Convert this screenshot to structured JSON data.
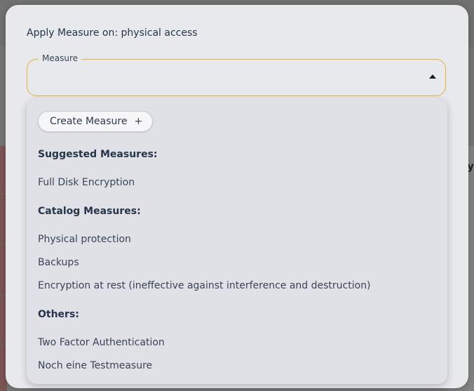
{
  "dialog": {
    "title": "Apply Measure on: physical access",
    "measure_field": {
      "label": "Measure",
      "value": ""
    }
  },
  "dropdown": {
    "create_button_label": "Create Measure",
    "create_button_icon": "+",
    "groups": [
      {
        "heading": "Suggested Measures:",
        "options": [
          "Full Disk Encryption"
        ]
      },
      {
        "heading": "Catalog Measures:",
        "options": [
          "Physical protection",
          "Backups",
          "Encryption at rest (ineffective against interference and destruction)"
        ]
      },
      {
        "heading": "Others:",
        "options": [
          "Two Factor Authentication",
          "Noch eine Testmeasure"
        ]
      }
    ]
  },
  "background": {
    "edge_text": "ry"
  },
  "colors": {
    "field_border": "#e6b13f",
    "dialog_bg": "#e8e9ec",
    "dropdown_bg": "#dfe1e6",
    "text_dark": "#27344a"
  }
}
